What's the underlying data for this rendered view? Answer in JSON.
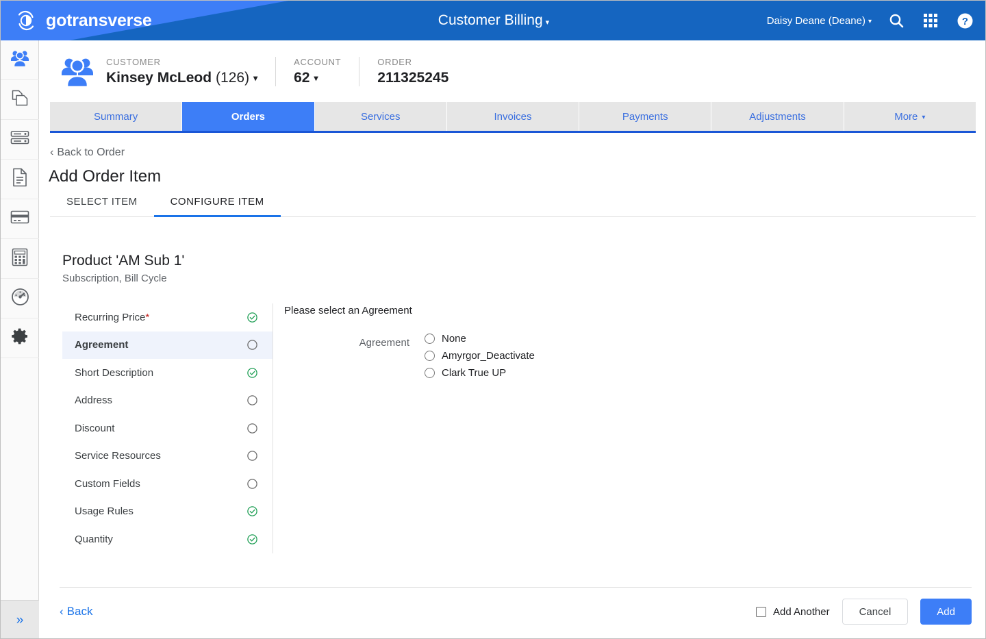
{
  "topbar": {
    "brand": "gotransverse",
    "brand_logo_icon": "gotransverse-circle-logo-icon",
    "app_title": "Customer Billing",
    "app_title_caret": "▾",
    "user": "Daisy Deane (Deane)",
    "user_caret": "▾",
    "icons": [
      {
        "name": "search-icon",
        "label": "Search"
      },
      {
        "name": "apps-grid-icon",
        "label": "Apps"
      },
      {
        "name": "help-icon",
        "label": "Help"
      }
    ],
    "colors": {
      "dark_blue": "#1565c0",
      "light_blue": "#3d7ef7"
    }
  },
  "rail": {
    "items": [
      {
        "icon": "customers-group-icon",
        "label": "Customers",
        "active": true
      },
      {
        "icon": "copy-documents-icon",
        "label": "Products"
      },
      {
        "icon": "server-stack-icon",
        "label": "Catalog"
      },
      {
        "icon": "document-icon",
        "label": "Invoices"
      },
      {
        "icon": "credit-card-icon",
        "label": "Payments"
      },
      {
        "icon": "calculator-icon",
        "label": "Billing"
      },
      {
        "icon": "gauge-dashboard-icon",
        "label": "Dashboard"
      },
      {
        "icon": "gear-icon",
        "label": "Settings"
      }
    ],
    "expand_icon": "double-chevron-right-icon",
    "expand_label": "»"
  },
  "context": {
    "icon": "customer-group-icon",
    "groups": [
      {
        "label": "CUSTOMER",
        "value": "Kinsey McLeod",
        "paren": "(126)",
        "caret": "▾"
      },
      {
        "label": "ACCOUNT",
        "value": "62",
        "paren": "",
        "caret": "▾"
      },
      {
        "label": "ORDER",
        "value": "211325245",
        "paren": "",
        "caret": ""
      }
    ]
  },
  "nav_tabs": [
    {
      "label": "Summary",
      "active": false,
      "caret": ""
    },
    {
      "label": "Orders",
      "active": true,
      "caret": ""
    },
    {
      "label": "Services",
      "active": false,
      "caret": ""
    },
    {
      "label": "Invoices",
      "active": false,
      "caret": ""
    },
    {
      "label": "Payments",
      "active": false,
      "caret": ""
    },
    {
      "label": "Adjustments",
      "active": false,
      "caret": ""
    },
    {
      "label": "More",
      "active": false,
      "caret": "▾"
    }
  ],
  "page": {
    "back_to_order": "Back to Order",
    "back_to_order_caret": "‹",
    "title": "Add Order Item",
    "sub_tabs": [
      {
        "label": "SELECT ITEM",
        "active": false
      },
      {
        "label": "CONFIGURE ITEM",
        "active": true
      }
    ],
    "product_title": "Product 'AM Sub 1'",
    "product_subtitle": "Subscription, Bill Cycle"
  },
  "attributes": [
    {
      "label": "Recurring Price",
      "required": true,
      "status": "complete",
      "selected": false
    },
    {
      "label": "Agreement",
      "required": false,
      "status": "empty",
      "selected": true
    },
    {
      "label": "Short Description",
      "required": false,
      "status": "complete",
      "selected": false
    },
    {
      "label": "Address",
      "required": false,
      "status": "empty",
      "selected": false
    },
    {
      "label": "Discount",
      "required": false,
      "status": "empty",
      "selected": false
    },
    {
      "label": "Service Resources",
      "required": false,
      "status": "empty",
      "selected": false
    },
    {
      "label": "Custom Fields",
      "required": false,
      "status": "empty",
      "selected": false
    },
    {
      "label": "Usage Rules",
      "required": false,
      "status": "complete",
      "selected": false
    },
    {
      "label": "Quantity",
      "required": false,
      "status": "complete",
      "selected": false
    }
  ],
  "form": {
    "intro": "Please select an Agreement",
    "field_label": "Agreement",
    "options": [
      {
        "label": "None",
        "selected": false
      },
      {
        "label": "Amyrgor_Deactivate",
        "selected": false
      },
      {
        "label": "Clark True UP",
        "selected": false
      }
    ]
  },
  "footer": {
    "back_label": "Back",
    "back_caret": "‹",
    "add_another_label": "Add Another",
    "add_another_checked": false,
    "cancel_label": "Cancel",
    "add_label": "Add"
  },
  "colors": {
    "primary": "#3d7ef7",
    "link": "#1a73e8",
    "success": "#34a853",
    "required": "#c5221f"
  }
}
